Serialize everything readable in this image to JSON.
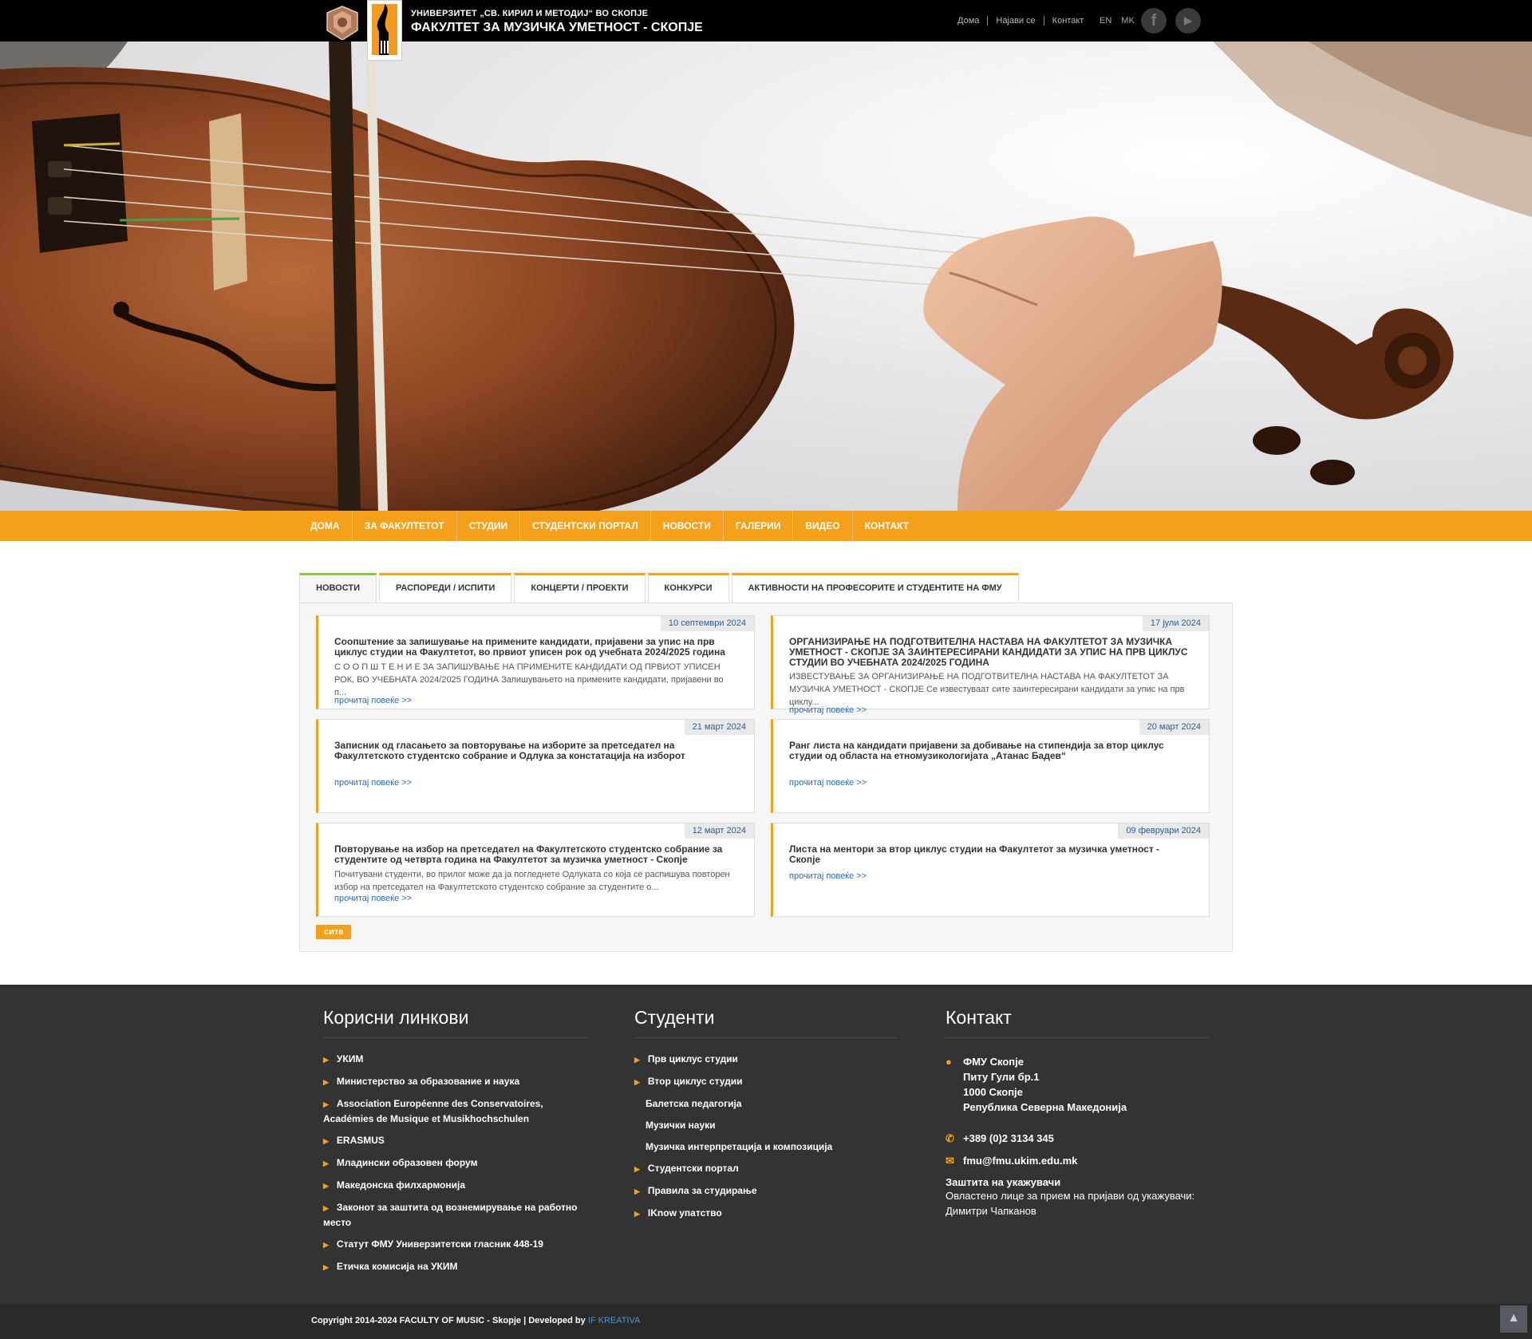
{
  "header": {
    "university": "УНИВЕРЗИТЕТ „СВ. КИРИЛ И МЕТОДИЈ“ ВО СКОПЈЕ",
    "faculty": "ФАКУЛТЕТ ЗА МУЗИЧКА УМЕТНОСТ - СКОПЈЕ",
    "links": [
      "Дома",
      "Најави се",
      "Контакт"
    ],
    "languages": [
      "EN",
      "MK"
    ],
    "social": [
      "facebook-icon",
      "youtube-icon"
    ]
  },
  "nav": [
    "ДОМА",
    "ЗА ФАКУЛТЕТОТ",
    "СТУДИИ",
    "СТУДЕНТСКИ ПОРТАЛ",
    "НОВОСТИ",
    "ГАЛЕРИИ",
    "ВИДЕО",
    "КОНТАКТ"
  ],
  "tabs": [
    "НОВОСТИ",
    "РАСПОРЕДИ / ИСПИТИ",
    "КОНЦЕРТИ / ПРОЕКТИ",
    "КОНКУРСИ",
    "АКТИВНОСТИ НА ПРОФЕСОРИТЕ И СТУДЕНТИТЕ НА ФМУ"
  ],
  "active_tab": "НОВОСТИ",
  "news": [
    {
      "date": "10 септември 2024",
      "title": "Соопштение за запишување на примените кандидати, пријавени за упис на прв циклус студии на Факултетот, во првиот уписен рок од учебната 2024/2025 година",
      "excerpt": "С О О П Ш Т Е Н И Е ЗА ЗАПИШУВАЊЕ НА ПРИМЕНИТЕ КАНДИДАТИ ОД ПРВИОТ УПИСЕН РОК, ВО УЧЕБНАТА 2024/2025 ГОДИНА   Запишувањето на примените кандидати, пријавени во п...",
      "more": "прочитај повеќе >>"
    },
    {
      "date": "17 јули 2024",
      "title": "ОРГАНИЗИРАЊЕ НА ПОДГОТВИТЕЛНА НАСТАВА НА ФАКУЛТЕТОТ ЗА МУЗИЧКА УМЕТНОСТ - СКОПЈЕ ЗА ЗАИНТЕРЕСИРАНИ КАНДИДАТИ ЗА УПИС НА ПРВ ЦИКЛУС СТУДИИ ВО УЧЕБНАТА 2024/2025 ГОДИНА",
      "excerpt": "ИЗВЕСТУВАЊЕ ЗА ОРГАНИЗИРАЊЕ НА ПОДГОТВИТЕЛНА НАСТАВА НА ФАКУЛТЕТОТ ЗА МУЗИЧКА УМЕТНОСТ - СКОПЈЕ   Се известуваат сите заинтересирани кандидати за упис на прв циклу...",
      "more": "прочитај повеќе >>"
    },
    {
      "date": "21 март 2024",
      "title": "Записник од гласањето за повторување на изборите за претседател на Факултетското студентско собрание и Одлука за констатација на изборот",
      "excerpt": "",
      "more": "прочитај повеќе >>"
    },
    {
      "date": "20 март 2024",
      "title": "Ранг листа на кандидати пријавени за добивање на стипендија за втор циклус студии од областа на етномузикологијата „Атанас Бадев“",
      "excerpt": "",
      "more": "прочитај повеќе >>"
    },
    {
      "date": "12 март 2024",
      "title": "Повторување на избор на претседател на Факултетското студентско собрание за студентите од четврта година на Факултетот за музичка уметност - Скопје",
      "excerpt": "Почитувани студенти, во прилог може да ја погледнете Одлуката со која се распишува повторен избор на претседател на Факултетското студентско собрание за студентите о...",
      "more": "прочитај повеќе >>"
    },
    {
      "date": "09 февруари 2024",
      "title": "Листа на ментори за втор циклус студии на Факултетот за музичка уметност - Скопје",
      "excerpt": "",
      "more": "прочитај повеќе >>"
    }
  ],
  "all_button": "сите",
  "footer": {
    "links_title": "Корисни линкови",
    "links": [
      "УКИМ",
      "Министерство за образование и наука",
      "Association Européenne des Conservatoires, Académies de Musique et Musikhochschulen",
      "ERASMUS",
      "Младински образовен форум",
      "Македонска филхармонија",
      "Законот за заштита од вознемирување на работно место",
      "Статут ФМУ Универзитетски гласник 448-19",
      "Етичка комисија на УКИМ"
    ],
    "students_title": "Студенти",
    "students": [
      {
        "label": "Прв циклус студии",
        "sub": false
      },
      {
        "label": "Втор циклус студии",
        "sub": false
      },
      {
        "label": "Балетска педагогија",
        "sub": true
      },
      {
        "label": "Музички науки",
        "sub": true
      },
      {
        "label": "Музичка интерпретација и композиција",
        "sub": true
      },
      {
        "label": "Студентски портал",
        "sub": false
      },
      {
        "label": "Правила за студирање",
        "sub": false
      },
      {
        "label": "IKnow упатство",
        "sub": false
      }
    ],
    "contact_title": "Контакт",
    "address": [
      "ФМУ Скопје",
      "Питу Гули бр.1",
      "1000 Скопје",
      "Република Северна Македонија"
    ],
    "phone": "+389 (0)2 3134 345",
    "email": "fmu@fmu.ukim.edu.mk",
    "whistle_title": "Заштита на укажувачи",
    "whistle_line1": "Овластено лице за прием на пријави од укажувачи:",
    "whistle_line2": "Димитри Чапканов"
  },
  "copyright": "Copyright 2014-2024 FACULTY OF MUSIC - Skopje | Developed by ",
  "developer": "IF KREATIVA",
  "colors": {
    "accent": "#f5a01a",
    "active_tab": "#8dc63f",
    "footer": "#333333",
    "link": "#2a6bbf"
  }
}
